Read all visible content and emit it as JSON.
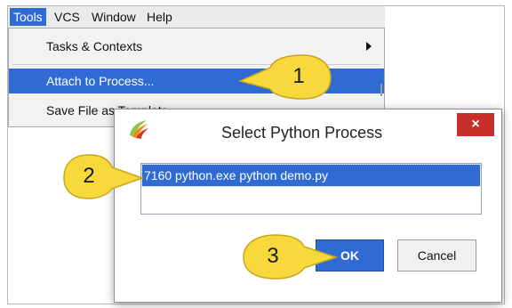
{
  "menubar": {
    "items": [
      {
        "label": "Tools",
        "active": true
      },
      {
        "label": "VCS"
      },
      {
        "label": "Window"
      },
      {
        "label": "Help"
      }
    ]
  },
  "tools_menu": {
    "items": [
      {
        "label": "Tasks & Contexts",
        "has_submenu": true
      },
      {
        "label": "Attach to Process...",
        "selected": true
      },
      {
        "label": "Save File as Template"
      }
    ]
  },
  "dialog": {
    "title": "Select Python Process",
    "close_label": "×",
    "processes": [
      {
        "label": "7160 python.exe   python  demo.py",
        "selected": true
      }
    ],
    "ok_label": "OK",
    "cancel_label": "Cancel"
  },
  "callouts": [
    "1",
    "2",
    "3"
  ],
  "colors": {
    "selection": "#2f6bd3",
    "close_button": "#c9302c",
    "callout_fill": "#f7d93d",
    "callout_stroke": "#c9a51a"
  }
}
